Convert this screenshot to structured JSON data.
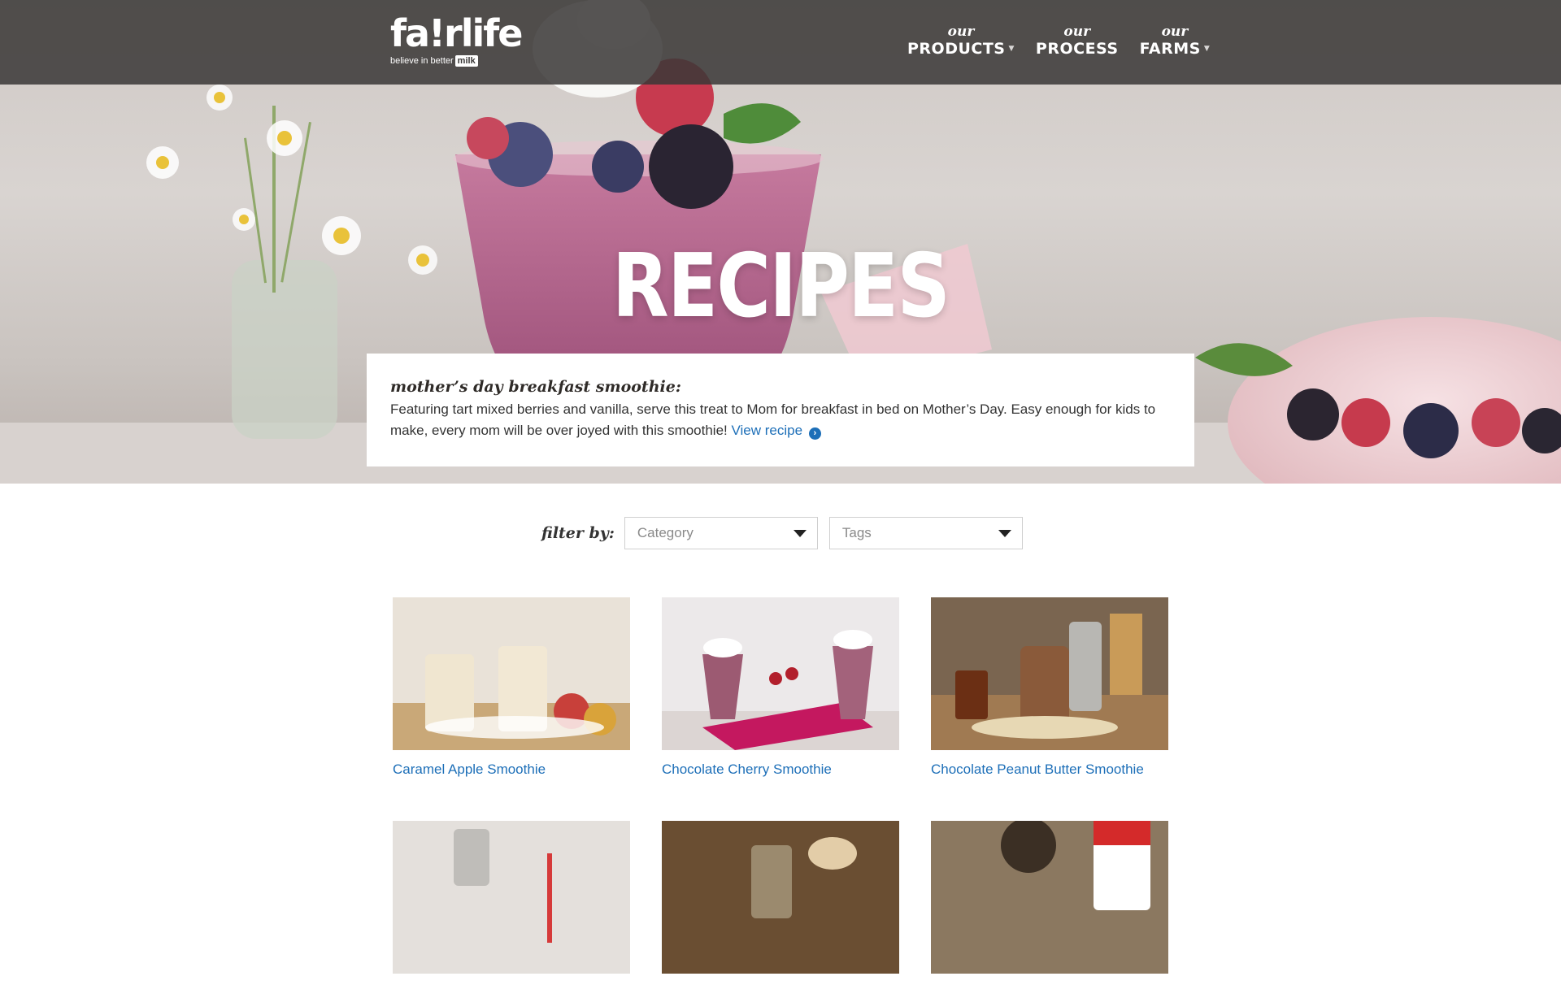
{
  "brand": {
    "name": "fa!rlife",
    "tagline": "believe in better",
    "tag_badge": "milk"
  },
  "nav": [
    {
      "small": "our",
      "big": "PRODUCTS",
      "dropdown": true
    },
    {
      "small": "our",
      "big": "PROCESS",
      "dropdown": false
    },
    {
      "small": "our",
      "big": "FARMS",
      "dropdown": true
    }
  ],
  "hero": {
    "title": "RECIPES"
  },
  "featured": {
    "heading": "mother’s day breakfast smoothie:",
    "text": "Featuring tart mixed berries and vanilla, serve this treat to Mom for breakfast in bed on Mother’s Day. Easy enough for kids to make, every mom will be over joyed with this smoothie!",
    "link_label": "View recipe"
  },
  "filter": {
    "label": "filter by:",
    "category_placeholder": "Category",
    "tags_placeholder": "Tags"
  },
  "recipes": [
    {
      "title": "Caramel Apple Smoothie"
    },
    {
      "title": "Chocolate Cherry Smoothie"
    },
    {
      "title": "Chocolate Peanut Butter Smoothie"
    },
    {
      "title": ""
    },
    {
      "title": ""
    },
    {
      "title": ""
    }
  ],
  "colors": {
    "link": "#1d6fb8",
    "nav_bg": "#3a3837",
    "text": "#333333"
  }
}
